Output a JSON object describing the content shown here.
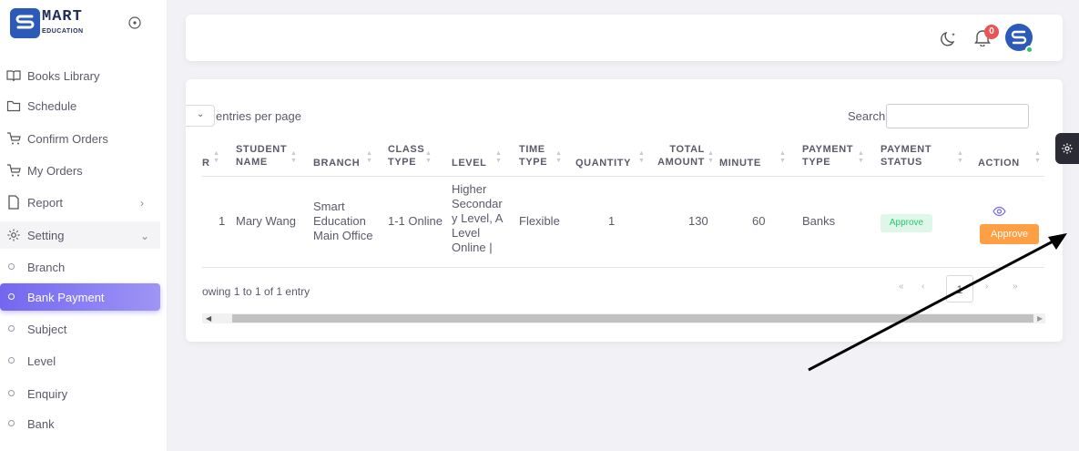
{
  "brand": {
    "title": "MART",
    "subtitle": "EDUCATION"
  },
  "sidebar": {
    "items": [
      {
        "label": "Books Library",
        "icon": "book-icon"
      },
      {
        "label": "Schedule",
        "icon": "folder-icon"
      },
      {
        "label": "Confirm Orders",
        "icon": "cart-icon"
      },
      {
        "label": "My Orders",
        "icon": "cart-icon"
      },
      {
        "label": "Report",
        "icon": "file-icon"
      },
      {
        "label": "Setting",
        "icon": "gear-icon"
      }
    ],
    "sub_items": [
      "Branch",
      "Bank Payment",
      "Subject",
      "Level",
      "Enquiry",
      "Bank"
    ],
    "active": "Bank Payment"
  },
  "topbar": {
    "notification_count": "0"
  },
  "table": {
    "entries_label": "entries per page",
    "search_label": "Search:",
    "search_value": "",
    "headers": {
      "col0": "R",
      "student": [
        "STUDENT",
        "NAME"
      ],
      "branch": "BRANCH",
      "class": [
        "CLASS",
        "TYPE"
      ],
      "level": "LEVEL",
      "time": [
        "TIME",
        "TYPE"
      ],
      "quantity": "QUANTITY",
      "total": [
        "TOTAL",
        "AMOUNT"
      ],
      "minute": "MINUTE",
      "ptype": [
        "PAYMENT",
        "TYPE"
      ],
      "pstatus": [
        "PAYMENT",
        "STATUS"
      ],
      "action": "ACTION"
    },
    "row": {
      "no": "1",
      "student_name": "Mary Wang",
      "branch": [
        "Smart",
        "Education",
        "Main Office"
      ],
      "class_type": "1-1 Online",
      "level": [
        "Higher",
        "Secondar",
        "y Level, A",
        "Level",
        "Online |"
      ],
      "time_type": "Flexible",
      "quantity": "1",
      "total_amount": "130",
      "minute": "60",
      "payment_type": "Banks",
      "payment_status": "Approve",
      "action_button": "Approve"
    },
    "showing_text": "owing 1 to 1 of 1 entry",
    "pagination": {
      "first": "«",
      "prev": "‹",
      "current": "1",
      "next": "›",
      "last": "»"
    }
  },
  "colors": {
    "accent": "#7367f0",
    "brand": "#2c5ab8",
    "warning": "#ff9f43",
    "success": "#28c76f",
    "danger": "#ea5455"
  }
}
